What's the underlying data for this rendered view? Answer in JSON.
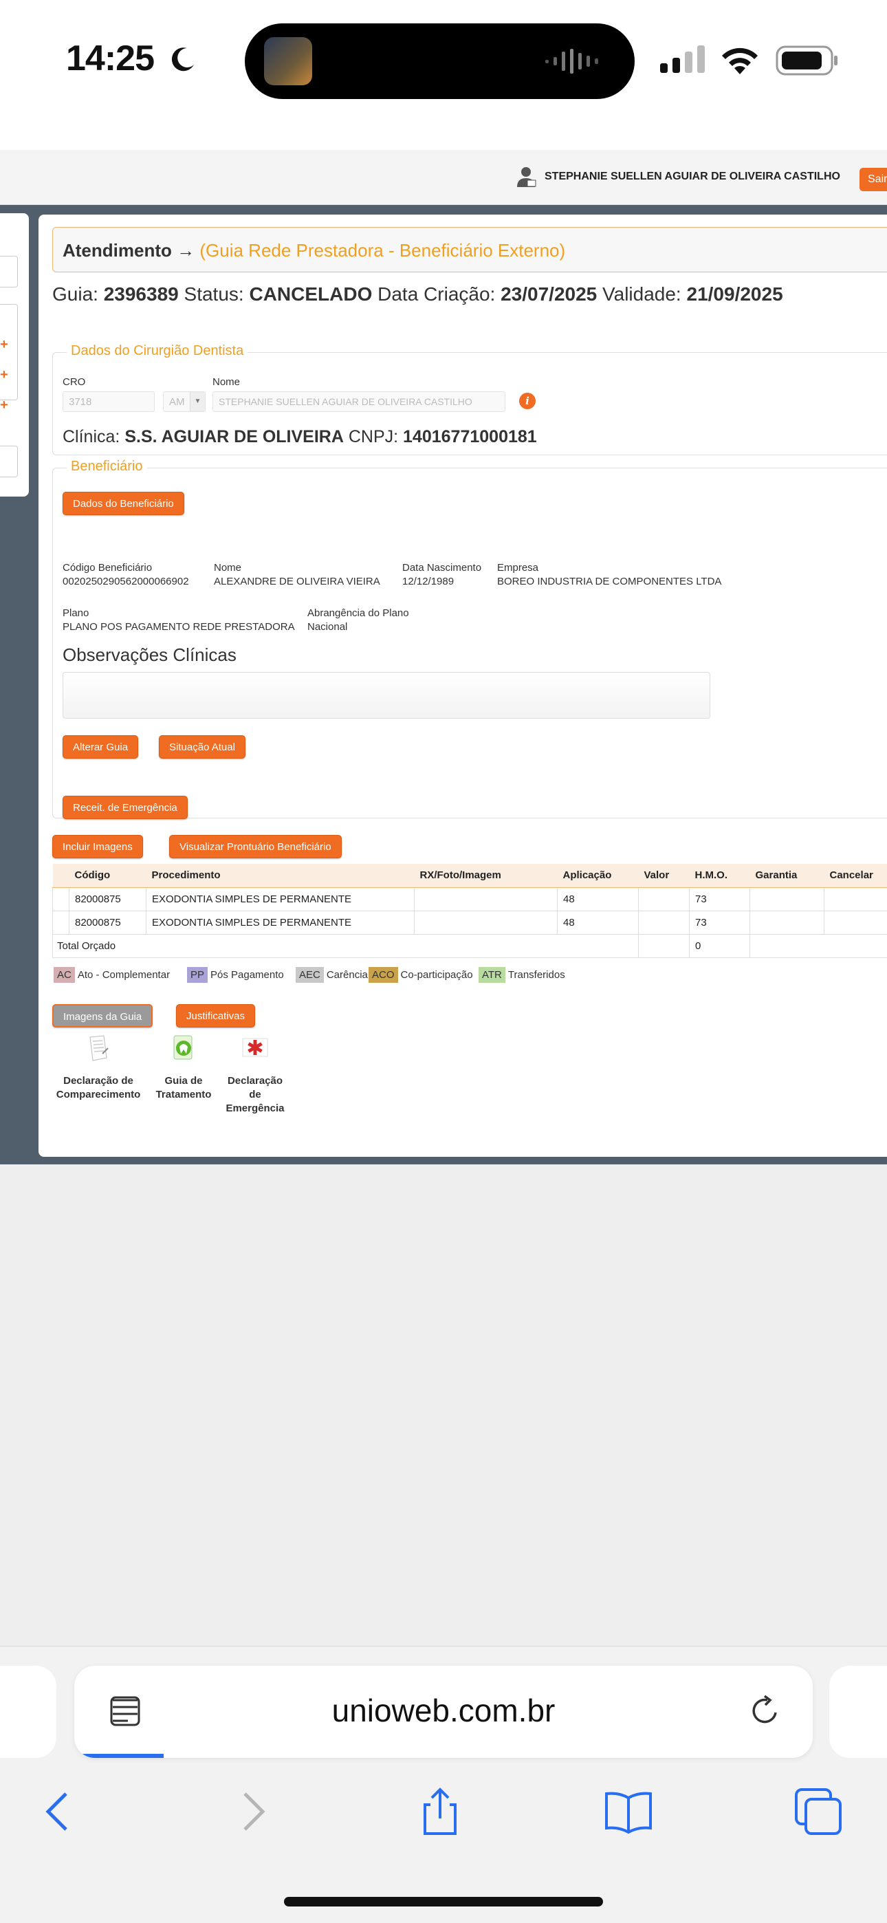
{
  "status_bar": {
    "time": "14:25"
  },
  "header": {
    "user_name": "STEPHANIE SUELLEN AGUIAR DE OLIVEIRA CASTILHO",
    "logout_label": "Sair"
  },
  "page": {
    "title": "Atendimento",
    "arrow": "→",
    "subtitle": "(Guia Rede Prestadora - Beneficiário Externo)",
    "guide_label": "Guia:",
    "guide_value": "2396389",
    "status_label": "Status:",
    "status_value": "CANCELADO",
    "created_label": "Data Criação:",
    "created_value": "23/07/2025",
    "validity_label": "Validade:",
    "validity_value": "21/09/2025"
  },
  "dentist": {
    "legend": "Dados do Cirurgião Dentista",
    "cro_label": "CRO",
    "cro_value": "3718",
    "uf_value": "AM",
    "name_label": "Nome",
    "name_value": "STEPHANIE SUELLEN AGUIAR DE OLIVEIRA CASTILHO",
    "clinic_label": "Clínica:",
    "clinic_value": "S.S. AGUIAR DE OLIVEIRA",
    "cnpj_label": "CNPJ:",
    "cnpj_value": "14016771000181"
  },
  "beneficiary": {
    "legend": "Beneficiário",
    "data_button": "Dados do Beneficiário",
    "code_label": "Código Beneficiário",
    "code_value": "0020250290562000066902",
    "name_label": "Nome",
    "name_value": "ALEXANDRE DE OLIVEIRA VIEIRA",
    "birth_label": "Data Nascimento",
    "birth_value": "12/12/1989",
    "company_label": "Empresa",
    "company_value": "BOREO INDUSTRIA DE COMPONENTES LTDA",
    "plan_label": "Plano",
    "plan_value": "PLANO POS PAGAMENTO REDE PRESTADORA",
    "coverage_label": "Abrangência do Plano",
    "coverage_value": "Nacional",
    "obs_title": "Observações Clínicas",
    "alter_button": "Alterar Guia",
    "situation_button": "Situação Atual",
    "emergency_button": "Receit. de Emergência"
  },
  "actions": {
    "include_images": "Incluir Imagens",
    "view_record": "Visualizar Prontuário Beneficiário"
  },
  "procedures": {
    "headers": [
      "Código",
      "Procedimento",
      "RX/Foto/Imagem",
      "Aplicação",
      "Valor",
      "H.M.O.",
      "Garantia",
      "Cancelar"
    ],
    "rows": [
      [
        "82000875",
        "EXODONTIA SIMPLES DE PERMANENTE",
        "",
        "48",
        "",
        "73",
        "",
        ""
      ],
      [
        "82000875",
        "EXODONTIA SIMPLES DE PERMANENTE",
        "",
        "48",
        "",
        "73",
        "",
        ""
      ]
    ],
    "total_label": "Total Orçado",
    "total_hmo": "0"
  },
  "legend_tags": [
    {
      "code": "AC",
      "label": "Ato - Complementar",
      "color": "#d4aeb0"
    },
    {
      "code": "PP",
      "label": "Pós Pagamento",
      "color": "#a9a3d8"
    },
    {
      "code": "AEC",
      "label": "Carência",
      "color": "#c8c8c8"
    },
    {
      "code": "ACO",
      "label": "Co-participação",
      "color": "#c9a24a"
    },
    {
      "code": "ATR",
      "label": "Transferidos",
      "color": "#b8dca0"
    }
  ],
  "guide_buttons": {
    "images": "Imagens da Guia",
    "justifications": "Justificativas"
  },
  "documents": [
    {
      "line1": "Declaração de",
      "line2": "Comparecimento",
      "line3": "",
      "icon": "document-icon"
    },
    {
      "line1": "Guia de",
      "line2": "Tratamento",
      "line3": "",
      "icon": "tooth-icon"
    },
    {
      "line1": "Declaração",
      "line2": "de",
      "line3": "Emergência",
      "icon": "medical-star-icon"
    }
  ],
  "browser": {
    "url": "unioweb.com.br"
  }
}
